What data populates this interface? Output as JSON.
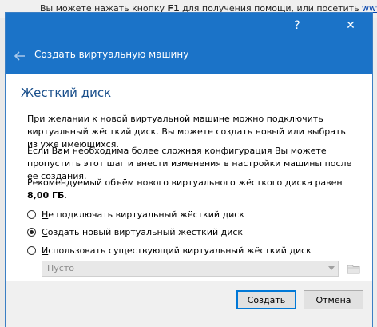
{
  "background": {
    "text_before": "Вы можете нажать кнопку ",
    "key": "F1",
    "text_after": " для получения помощи, или посетить ",
    "link": "www.virtualbox"
  },
  "titlebar": {
    "help_glyph": "?",
    "close_glyph": "✕"
  },
  "header": {
    "title": "Создать виртуальную машину"
  },
  "section": {
    "title": "Жесткий диск"
  },
  "paragraphs": {
    "p1": "При желании к новой виртуальной машине можно подключить виртуальный жёсткий диск. Вы можете создать новый или выбрать из уже имеющихся.",
    "p2": "Если Вам необходима более сложная конфигурация Вы можете пропустить этот шаг и внести изменения в настройки машины после её создания.",
    "p3_prefix": "Рекомендуемый объём нового виртуального жёсткого диска равен ",
    "p3_value": "8,00 ГБ",
    "p3_suffix": "."
  },
  "options": [
    {
      "accel": "Н",
      "rest": "е подключать виртуальный жёсткий диск",
      "checked": false
    },
    {
      "accel": "С",
      "rest": "оздать новый виртуальный жёсткий диск",
      "checked": true
    },
    {
      "accel": "И",
      "rest": "спользовать существующий виртуальный жёсткий диск",
      "checked": false
    }
  ],
  "combo": {
    "value": "Пусто"
  },
  "buttons": {
    "create": "Создать",
    "cancel": "Отмена"
  },
  "colors": {
    "accent": "#1b73c8",
    "section_title": "#1a4f8b"
  }
}
